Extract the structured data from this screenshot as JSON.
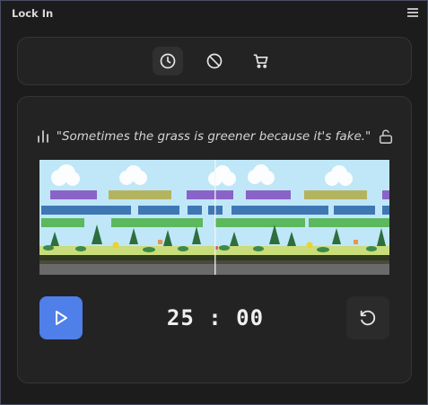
{
  "window": {
    "title": "Lock In",
    "menu_icon": "hamburger-icon"
  },
  "tabs": [
    {
      "icon": "clock-icon",
      "active": true
    },
    {
      "icon": "block-icon",
      "active": false
    },
    {
      "icon": "cart-icon",
      "active": false
    }
  ],
  "quote": {
    "stats_icon": "stats-icon",
    "text": "\"Sometimes the grass is greener because it's fake.\"",
    "lock_icon": "unlock-icon"
  },
  "scene": {
    "description_icon": "pixel-landscape",
    "colors": {
      "sky": "#bfe7f7",
      "purple": "#8a63c8",
      "olive": "#b5b45e",
      "blue": "#3f77b5",
      "green": "#5cb85c",
      "grass": "#c9dd7a",
      "ground_dark": "#2f3a1f",
      "road": "#6a6a6a"
    }
  },
  "controls": {
    "play_icon": "play-icon",
    "timer": "25 : 00",
    "reset_icon": "reset-icon"
  },
  "colors": {
    "accent": "#4f7fe8",
    "background": "#1c1c1c",
    "panel": "#232323",
    "border": "#4a4d63"
  }
}
